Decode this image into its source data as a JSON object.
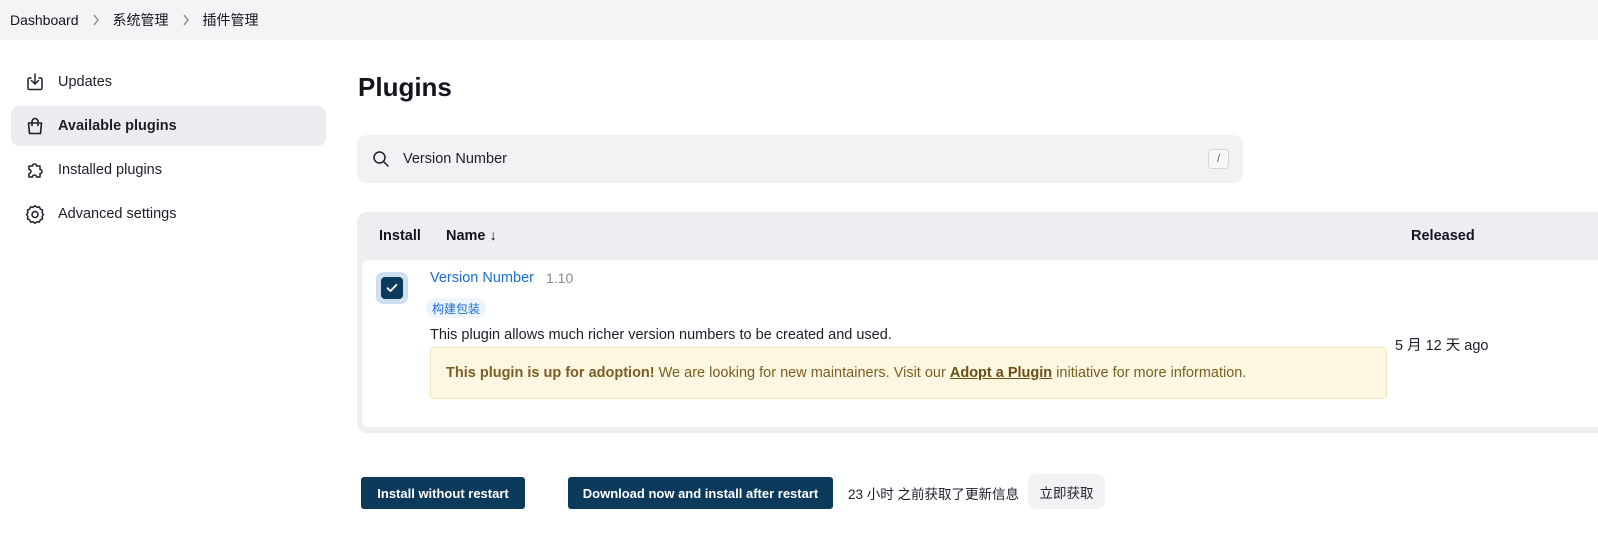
{
  "breadcrumb": {
    "items": [
      "Dashboard",
      "系统管理",
      "插件管理"
    ]
  },
  "sidebar": {
    "items": [
      {
        "label": "Updates",
        "icon": "download-icon"
      },
      {
        "label": "Available plugins",
        "icon": "shopping-bag-icon",
        "active": true
      },
      {
        "label": "Installed plugins",
        "icon": "puzzle-icon"
      },
      {
        "label": "Advanced settings",
        "icon": "gear-icon"
      }
    ]
  },
  "main": {
    "title": "Plugins",
    "search": {
      "value": "Version Number",
      "shortcut": "/"
    },
    "table": {
      "headers": {
        "install": "Install",
        "name": "Name ↓",
        "released": "Released"
      },
      "rows": [
        {
          "checked": true,
          "name": "Version Number",
          "version": "1.10",
          "tag": "构建包装",
          "description": "This plugin allows much richer version numbers to be created and used.",
          "adoption": {
            "bold": "This plugin is up for adoption!",
            "text_before": " We are looking for new maintainers. Visit our ",
            "link": "Adopt a Plugin",
            "text_after": " initiative for more information."
          },
          "released": "5 月 12 天 ago"
        }
      ]
    }
  },
  "actions": {
    "install_without_restart": "Install without restart",
    "download_install_after_restart": "Download now and install after restart",
    "update_info": "23 小时 之前获取了更新信息",
    "fetch_now": "立即获取"
  },
  "colors": {
    "accent": "#0b3a5c",
    "link": "#1a6ed1",
    "adoption_bg": "#fdf6e1"
  }
}
